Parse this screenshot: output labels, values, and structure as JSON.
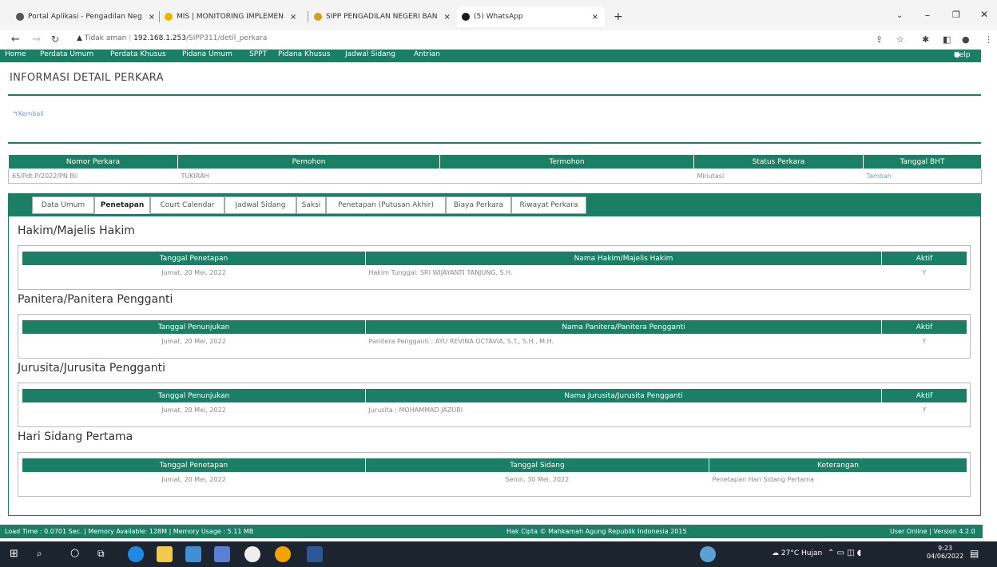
{
  "browser": {
    "tabs": [
      {
        "label": "Portal Aplikasi - Pengadilan Neg",
        "color": "#555555"
      },
      {
        "label": "MIS | MONITORING IMPLEMEN",
        "color": "#e6b800"
      },
      {
        "label": "SIPP PENGADILAN NEGERI BAN",
        "color": "#d4a017"
      },
      {
        "label": "(5) WhatsApp",
        "color": "#1a1a1a"
      }
    ],
    "close_glyph": "×",
    "new_tab": "+",
    "insecure_label": "Tidak aman",
    "url_host": "192.168.1.253",
    "url_path": "/SIPP311/detil_perkara"
  },
  "app_nav": {
    "items": [
      "Home",
      "Perdata Umum",
      "Perdata Khusus",
      "Pidana Umum",
      "SPPT",
      "Pidana Khusus",
      "Jadwal Sidang",
      "Antrian"
    ],
    "help": "Help"
  },
  "page_title": "INFORMASI DETAIL PERKARA",
  "back_link": "Kembali",
  "summary": {
    "headers": [
      "Nomor Perkara",
      "Pemohon",
      "Termohon",
      "Status Perkara",
      "Tanggal BHT"
    ],
    "row": [
      "65/Pdt.P/2022/PN Bli",
      "TUKIRAH",
      "",
      "Minutasi",
      "Tambah"
    ]
  },
  "tabs": [
    "Data Umum",
    "Penetapan",
    "Court Calendar",
    "Jadwal Sidang",
    "Saksi",
    "Penetapan (Putusan Akhir)",
    "Biaya Perkara",
    "Riwayat Perkara"
  ],
  "active_tab": "Penetapan",
  "sections": {
    "hakim": {
      "title": "Hakim/Majelis Hakim",
      "headers": [
        "Tanggal Penetapan",
        "Nama Hakim/Majelis Hakim",
        "Aktif"
      ],
      "row": [
        "Jumat, 20 Mei. 2022",
        "Hakim Tunggal: SRI WIJAYANTI TANJUNG, S.H.",
        "Y"
      ]
    },
    "panitera": {
      "title": "Panitera/Panitera Pengganti",
      "headers": [
        "Tanggal Penunjukan",
        "Nama Panitera/Panitera Pengganti",
        "Aktif"
      ],
      "row": [
        "Jumat, 20 Mei, 2022",
        "Panitera Pengganti : AYU REVINA OCTAVIA, S.T., S.H., M.H.",
        "Y"
      ]
    },
    "jurusita": {
      "title": "Jurusita/Jurusita Pengganti",
      "headers": [
        "Tanggal Penunjukan",
        "Nama Jurusita/Jurusita Pengganti",
        "Aktif"
      ],
      "row": [
        "Jumat, 20 Mei, 2022",
        "Jurusita : MOHAMMAD JAZURI",
        "Y"
      ]
    },
    "sidang": {
      "title": "Hari Sidang Pertama",
      "headers": [
        "Tanggal Penetapan",
        "Tanggal Sidang",
        "Keterangan"
      ],
      "row": [
        "Jumat, 20 Mei, 2022",
        "Senin, 30 Mei, 2022",
        "Penetapan Hari Sidang Pertama"
      ]
    }
  },
  "footer": {
    "left": "Load Time : 0.0701 Sec. | Memory Available: 128M | Memory Usage : 5.11 MB",
    "center": "Hak Cipta © Mahkamah Agung Republik Indonesia 2015",
    "right": "User Online | Version 4.2.0"
  },
  "taskbar": {
    "weather": "27°C Hujan",
    "time": "9:23",
    "date": "04/06/2022"
  },
  "colors": {
    "accent": "#1b7f66"
  }
}
